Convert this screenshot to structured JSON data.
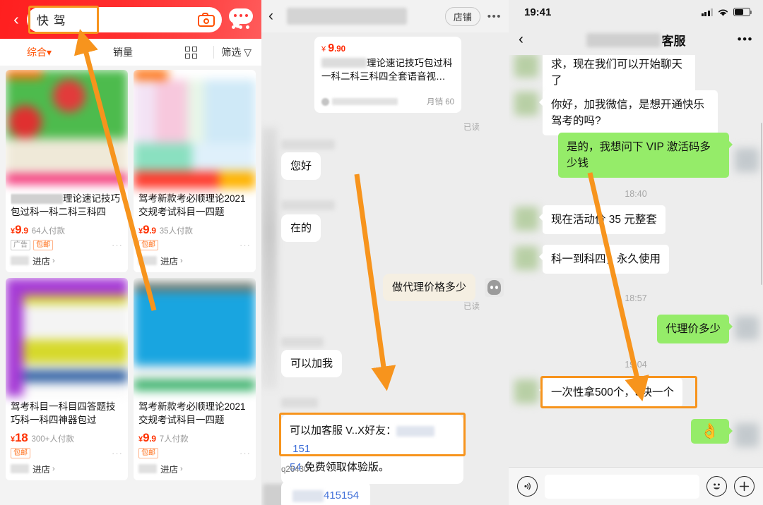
{
  "taobao": {
    "search": {
      "query": "快  驾",
      "camera_icon": "camera-icon",
      "back_icon": "back-chevron-icon",
      "chat_icon": "chat-bubble-icon"
    },
    "tabs": [
      {
        "label": "综合",
        "active": true,
        "caret": "▾"
      },
      {
        "label": "销量",
        "active": false
      },
      {
        "label": "筛选",
        "active": false,
        "caret": "▽"
      }
    ],
    "grid_icon": "grid-view-icon",
    "products": [
      {
        "title": "理论速记技巧包过科一科二科三科四",
        "currency": "¥",
        "price": "9",
        "price_dec": ".9",
        "sold": "64人付款",
        "badges": [
          "广告",
          "包邮"
        ],
        "shop": "进店",
        "shop_arrow": "›"
      },
      {
        "title": "驾考新款考必顺理论2021交规考试科目一四题",
        "currency": "¥",
        "price": "9",
        "price_dec": ".9",
        "sold": "35人付款",
        "badges": [
          "包邮"
        ],
        "shop": "进店",
        "shop_arrow": "›"
      },
      {
        "title": "驾考科目一科目四答题技巧科一科四神器包过",
        "currency": "¥",
        "price": "18",
        "price_dec": "",
        "sold": "300+人付款",
        "badges": [
          "包邮"
        ],
        "shop": "进店",
        "shop_arrow": "›"
      },
      {
        "title": "驾考新款考必顺理论2021交规考试科目一四题",
        "currency": "¥",
        "price": "9",
        "price_dec": ".9",
        "sold": "7人付款",
        "badges": [
          "包邮"
        ],
        "shop": "进店",
        "shop_arrow": "›"
      }
    ]
  },
  "tbchat": {
    "header": {
      "back_icon": "back-chevron-icon",
      "shop_button": "店铺",
      "more_icon": "more-dots-icon"
    },
    "product_card": {
      "currency": "¥",
      "price": "9",
      "price_dec": ".90",
      "title": "理论速记技巧包过科一科二科三科四全套语音视…",
      "monthly_sales": "月销 60"
    },
    "read_1": "已读",
    "read_2": "已读",
    "messages": [
      {
        "side": "left",
        "text": "您好"
      },
      {
        "side": "left",
        "text": "在的"
      },
      {
        "side": "right",
        "text": "做代理价格多少"
      },
      {
        "side": "left",
        "text": "可以加我"
      }
    ],
    "highlighted_message": {
      "line1_prefix": "可以加客服 V..X好友：",
      "line1_number": "151",
      "line2_number": "54",
      "line2_text": "免费领取体验版。"
    },
    "q_label": "q26430",
    "last_bubble_number": "415154"
  },
  "wechat": {
    "status": {
      "time": "19:41",
      "signal_icon": "signal-bars-icon",
      "wifi_icon": "wifi-icon",
      "battery_icon": "battery-icon"
    },
    "header": {
      "back_icon": "back-chevron-icon",
      "title": "客服",
      "more_icon": "more-dots-icon"
    },
    "messages": [
      {
        "side": "left",
        "text": "我通过了你的朋友验证请求，现在我们可以开始聊天了"
      },
      {
        "side": "left",
        "text": "你好，加我微信，是想开通快乐驾考的吗?"
      },
      {
        "side": "right",
        "text": "是的，我想问下 VIP 激活码多少钱"
      },
      {
        "side": "left",
        "text": "现在活动价 35 元整套"
      },
      {
        "side": "left",
        "text": "科一到科四，永久使用"
      },
      {
        "side": "right",
        "text": "代理价多少"
      },
      {
        "side": "left",
        "text": "一次性拿500个，5块一个",
        "highlighted": true
      },
      {
        "side": "right",
        "text": "👌",
        "emoji": true
      }
    ],
    "timestamps": [
      "18:40",
      "18:57",
      "19:04"
    ],
    "input": {
      "voice_icon": "voice-record-icon",
      "placeholder": "",
      "emoji_icon": "emoji-smiley-icon",
      "plus_icon": "plus-circle-icon"
    }
  },
  "annotations": {
    "arrow_color": "#f7941d",
    "highlight_color": "#f7941d"
  }
}
